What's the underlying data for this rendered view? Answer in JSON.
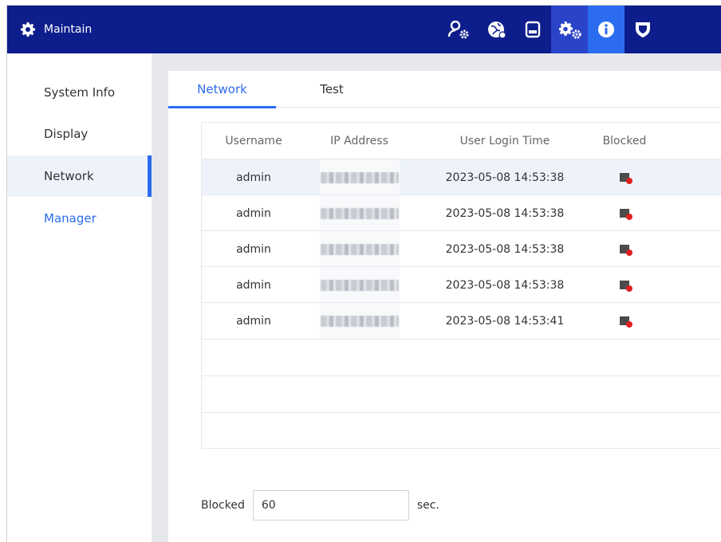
{
  "header": {
    "title": "Maintain",
    "icons": [
      "user-settings-icon",
      "network-globe-icon",
      "storage-icon",
      "system-settings-icon",
      "info-icon",
      "shield-icon"
    ]
  },
  "sidebar": {
    "items": [
      {
        "label": "System Info"
      },
      {
        "label": "Display"
      },
      {
        "label": "Network"
      },
      {
        "label": "Manager"
      }
    ]
  },
  "tabs": [
    {
      "label": "Network"
    },
    {
      "label": "Test"
    }
  ],
  "table": {
    "headers": [
      "Username",
      "IP Address",
      "User Login Time",
      "Blocked"
    ],
    "rows": [
      {
        "username": "admin",
        "login_time": "2023-05-08 14:53:38"
      },
      {
        "username": "admin",
        "login_time": "2023-05-08 14:53:38"
      },
      {
        "username": "admin",
        "login_time": "2023-05-08 14:53:38"
      },
      {
        "username": "admin",
        "login_time": "2023-05-08 14:53:38"
      },
      {
        "username": "admin",
        "login_time": "2023-05-08 14:53:41"
      }
    ]
  },
  "blocked": {
    "label": "Blocked",
    "value": "60",
    "unit": "sec."
  },
  "colors": {
    "header_bg": "#0d1d8c",
    "accent": "#2b6cf0"
  }
}
